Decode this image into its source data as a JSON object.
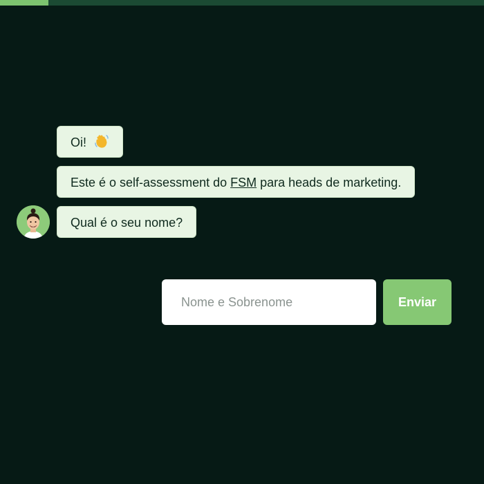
{
  "progress": {
    "fraction": 0.1
  },
  "chat": {
    "greeting": "Oi!",
    "greeting_icon": "waving-hand-icon",
    "intro_before": "Este é o self-assessment do ",
    "intro_link": "FSM",
    "intro_after": " para heads de marketing.",
    "question": "Qual é o seu nome?",
    "avatar_icon": "bot-avatar"
  },
  "form": {
    "name_placeholder": "Nome e Sobrenome",
    "name_value": "",
    "submit_label": "Enviar"
  },
  "colors": {
    "background": "#061a15",
    "accent": "#86c874",
    "bubble": "#e8f5e4"
  }
}
